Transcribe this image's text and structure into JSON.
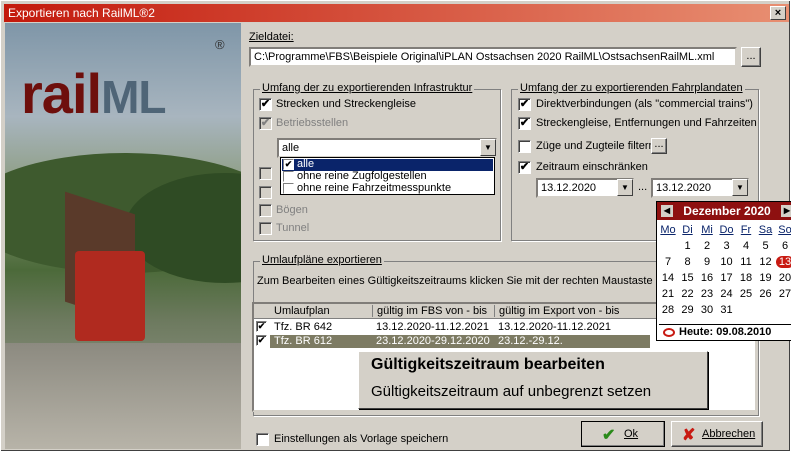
{
  "window": {
    "title": "Exportieren nach RailML®2",
    "close": "×"
  },
  "logo": {
    "rail": "rail",
    "ml": "ML",
    "reg": "®"
  },
  "zieldatei": {
    "label": "Zieldatei:",
    "path": "C:\\Programme\\FBS\\Beispiele Original\\iPLAN Ostsachsen 2020 RailML\\OstsachsenRailML.xml",
    "browse": "..."
  },
  "infra": {
    "title": "Umfang der zu exportierenden Infrastruktur",
    "strecken": "Strecken und Streckengleise",
    "betriebsstellen": "Betriebsstellen",
    "filter_value": "alle",
    "dropdown": [
      "alle",
      "ohne reine Zugfolgestellen",
      "ohne reine Fahrzeitmesspunkte"
    ],
    "boegen": "Bögen",
    "tunnel": "Tunnel"
  },
  "fahrplan": {
    "title": "Umfang der zu exportierenden Fahrplandaten",
    "direkt": "Direktverbindungen (als \"commercial trains\")",
    "streckengleise": "Streckengleise, Entfernungen und Fahrzeiten",
    "zuege": "Züge und Zugteile filtern",
    "zeitraum": "Zeitraum einschränken",
    "von": "13.12.2020",
    "sep": "...",
    "bis": "13.12.2020"
  },
  "calendar": {
    "month": "Dezember 2020",
    "days": [
      "Mo",
      "Di",
      "Mi",
      "Do",
      "Fr",
      "Sa",
      "So"
    ],
    "rows": [
      [
        "",
        "1",
        "2",
        "3",
        "4",
        "5",
        "6"
      ],
      [
        "7",
        "8",
        "9",
        "10",
        "11",
        "12",
        "13"
      ],
      [
        "14",
        "15",
        "16",
        "17",
        "18",
        "19",
        "20"
      ],
      [
        "21",
        "22",
        "23",
        "24",
        "25",
        "26",
        "27"
      ],
      [
        "28",
        "29",
        "30",
        "31",
        "",
        "",
        ""
      ]
    ],
    "today": "Heute: 09.08.2010"
  },
  "umlauf": {
    "title": "Umlaufpläne exportieren",
    "hint": "Zum Bearbeiten eines Gültigkeitszeitraums klicken Sie mit der rechten Maustaste auf ein",
    "cols": [
      "Umlaufplan",
      "gültig im FBS von - bis",
      "gültig im Export von - bis"
    ],
    "rows": [
      {
        "name": "Tfz. BR 642",
        "fbs": "13.12.2020-11.12.2021",
        "export": "13.12.2020-11.12.2021"
      },
      {
        "name": "Tfz. BR 612",
        "fbs": "23.12.2020-29.12.2020",
        "export": "23.12.-29.12."
      }
    ]
  },
  "context_menu": {
    "item1": "Gültigkeitszeitraum bearbeiten",
    "item2": "Gültigkeitszeitraum auf unbegrenzt setzen"
  },
  "footer": {
    "vorlage": "Einstellungen als Vorlage speichern",
    "ok": "Ok",
    "abbrechen": "Abbrechen"
  }
}
